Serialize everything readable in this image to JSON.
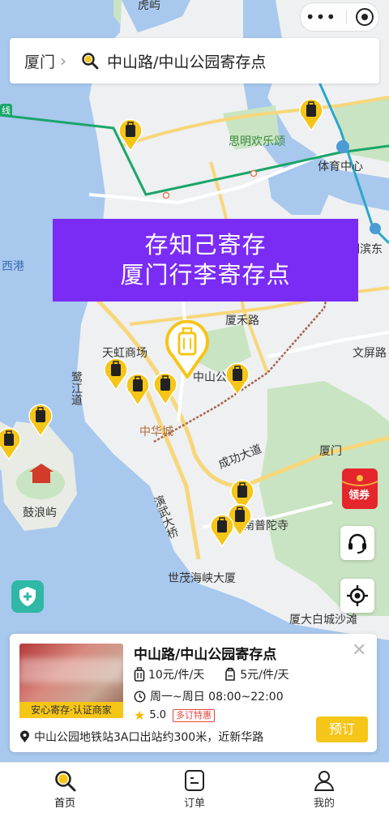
{
  "header": {
    "city": "厦门",
    "query": "中山路/中山公园寄存点"
  },
  "map": {
    "labels": {
      "huyu": "虎屿",
      "siming_park": "思明欢乐颂",
      "sports_center": "体育中心",
      "xigang": "西港",
      "binhe_east": "湖滨东",
      "xiahe_road": "厦禾路",
      "tianhong": "天虹商场",
      "zhongshan_park": "中山公",
      "wenping_road": "文屏路",
      "lujiang_road": "鹭江道",
      "zhonghua_city": "中华城",
      "gulangyu": "鼓浪屿",
      "chenggong_ave": "成功大道",
      "xiamen": "厦门",
      "yanwu_bridge": "演武大桥",
      "nanputuo": "南普陀寺",
      "shimao": "世茂海峡大厦",
      "baicheng": "厦大白城沙滩",
      "line": "线"
    }
  },
  "banner": {
    "line1": "存知己寄存",
    "line2": "厦门行李寄存点"
  },
  "coupon": {
    "label": "领券"
  },
  "card": {
    "title": "中山路/中山公园寄存点",
    "badge": "安心寄存·认证商家",
    "price_large": "10元/件/天",
    "price_small": "5元/件/天",
    "hours": "周一~周日 08:00~22:00",
    "rating": "5.0",
    "discount_tag": "多订特惠",
    "address": "中山公园地铁站3A口出站约300米，近新华路",
    "book_label": "预订"
  },
  "tabs": [
    {
      "label": "首页",
      "icon": "search-icon",
      "active": true
    },
    {
      "label": "订单",
      "icon": "order-icon",
      "active": false
    },
    {
      "label": "我的",
      "icon": "profile-icon",
      "active": false
    }
  ],
  "colors": {
    "accent_yellow": "#f5c518",
    "banner_purple": "#7a2cf5",
    "water": "#a8c8ee",
    "land": "#eef0f1",
    "green": "#c9e4c2"
  }
}
